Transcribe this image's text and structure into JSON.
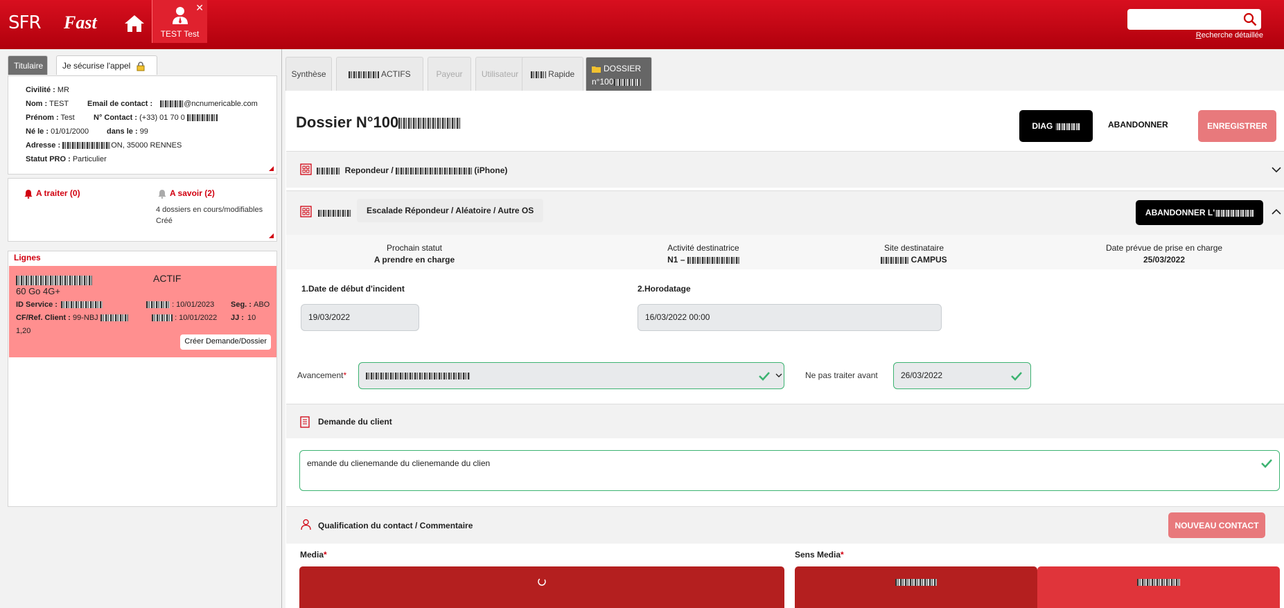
{
  "topbar": {
    "logo_sfr": "SFR",
    "logo_app": "Fast",
    "client_tab_name": "TEST Test",
    "close_glyph": "✕",
    "search_placeholder": "",
    "advanced_search_first": "R",
    "advanced_search_rest": "echerche détaillée"
  },
  "left_tabs": {
    "holder": "Titulaire",
    "secure_call": "Je sécurise l'appel"
  },
  "holder": {
    "civility_label": "Civilité :",
    "civility": "MR",
    "lastname_label": "Nom :",
    "lastname": "TEST",
    "email_label": "Email de contact :",
    "email_suffix": "@ncnumericable.com",
    "firstname_label": "Prénom :",
    "firstname": "Test",
    "contact_label": "N° Contact :",
    "contact": "(+33) 01 70 0",
    "birth_label": "Né le :",
    "birth": "01/01/2000",
    "dept_label": "dans le :",
    "dept": "99",
    "address_label": "Adresse :",
    "address": "ON, 35000 RENNES",
    "pro_label": "Statut PRO :",
    "pro": "Particulier"
  },
  "alerts": {
    "to_process": "A traiter (0)",
    "to_know": "A savoir (2)",
    "desc_line1": "4 dossiers en cours/modifiables",
    "desc_line2": "Créé"
  },
  "lines": {
    "title": "Lignes",
    "status": "ACTIF",
    "offer": "60 Go 4G+",
    "id_label": "ID Service :",
    "date1": ": 10/01/2023",
    "seg_label": "Seg. :",
    "seg": "ABO",
    "cf_label": "CF/Ref. Client :",
    "cf": "99-NBJ",
    "date2": ": 10/01/2022",
    "jj_label": "JJ :",
    "jj": "10",
    "extra": "1,20",
    "create_button": "Créer Demande/Dossier"
  },
  "right_tabs": {
    "synthese": "Synthèse",
    "actifs": "ACTIFS",
    "payeur": "Payeur",
    "utilisateur": "Utilisateur",
    "rapide": "Rapide",
    "dossier_line1": "DOSSIER",
    "dossier_line2": "n°100"
  },
  "dossier": {
    "title": "Dossier N°100",
    "diag_button": "DIAG",
    "abandon_button": "ABANDONNER",
    "save_button": "ENREGISTRER"
  },
  "motif": {
    "item1": "Repondeur",
    "sep": "/",
    "item2": "(iPhone)"
  },
  "escalade": {
    "item1": "Escalade Répondeur",
    "item2": "Aléatoire",
    "item3": "Autre OS",
    "abandon_escalade_button": "ABANDONNER L'"
  },
  "info": {
    "next_status_label": "Prochain statut",
    "next_status": "A prendre en charge",
    "activity_label": "Activité destinatrice",
    "activity": "N1 –",
    "site_label": "Site destinataire",
    "site": "CAMPUS",
    "date_label": "Date prévue de prise en charge",
    "date": "25/03/2022"
  },
  "form": {
    "incident_label": "1.Date de début d'incident",
    "incident_value": "19/03/2022",
    "horodatage_label": "2.Horodatage",
    "horodatage_value": "16/03/2022 00:00",
    "avancement_label": "Avancement",
    "avancement_value": "",
    "not_before_label": "Ne pas traiter avant",
    "not_before_value": "26/03/2022",
    "required_mark": "*"
  },
  "demande": {
    "title": "Demande du client",
    "text": "emande du clienemande du clienemande du clien"
  },
  "qualification": {
    "title": "Qualification du contact / Commentaire",
    "new_contact_button": "NOUVEAU CONTACT",
    "media_label": "Media",
    "sens_label": "Sens Media"
  },
  "colors": {
    "brand_red": "#d10010",
    "success_green": "#3cb371",
    "soft_red": "#e8797c"
  }
}
